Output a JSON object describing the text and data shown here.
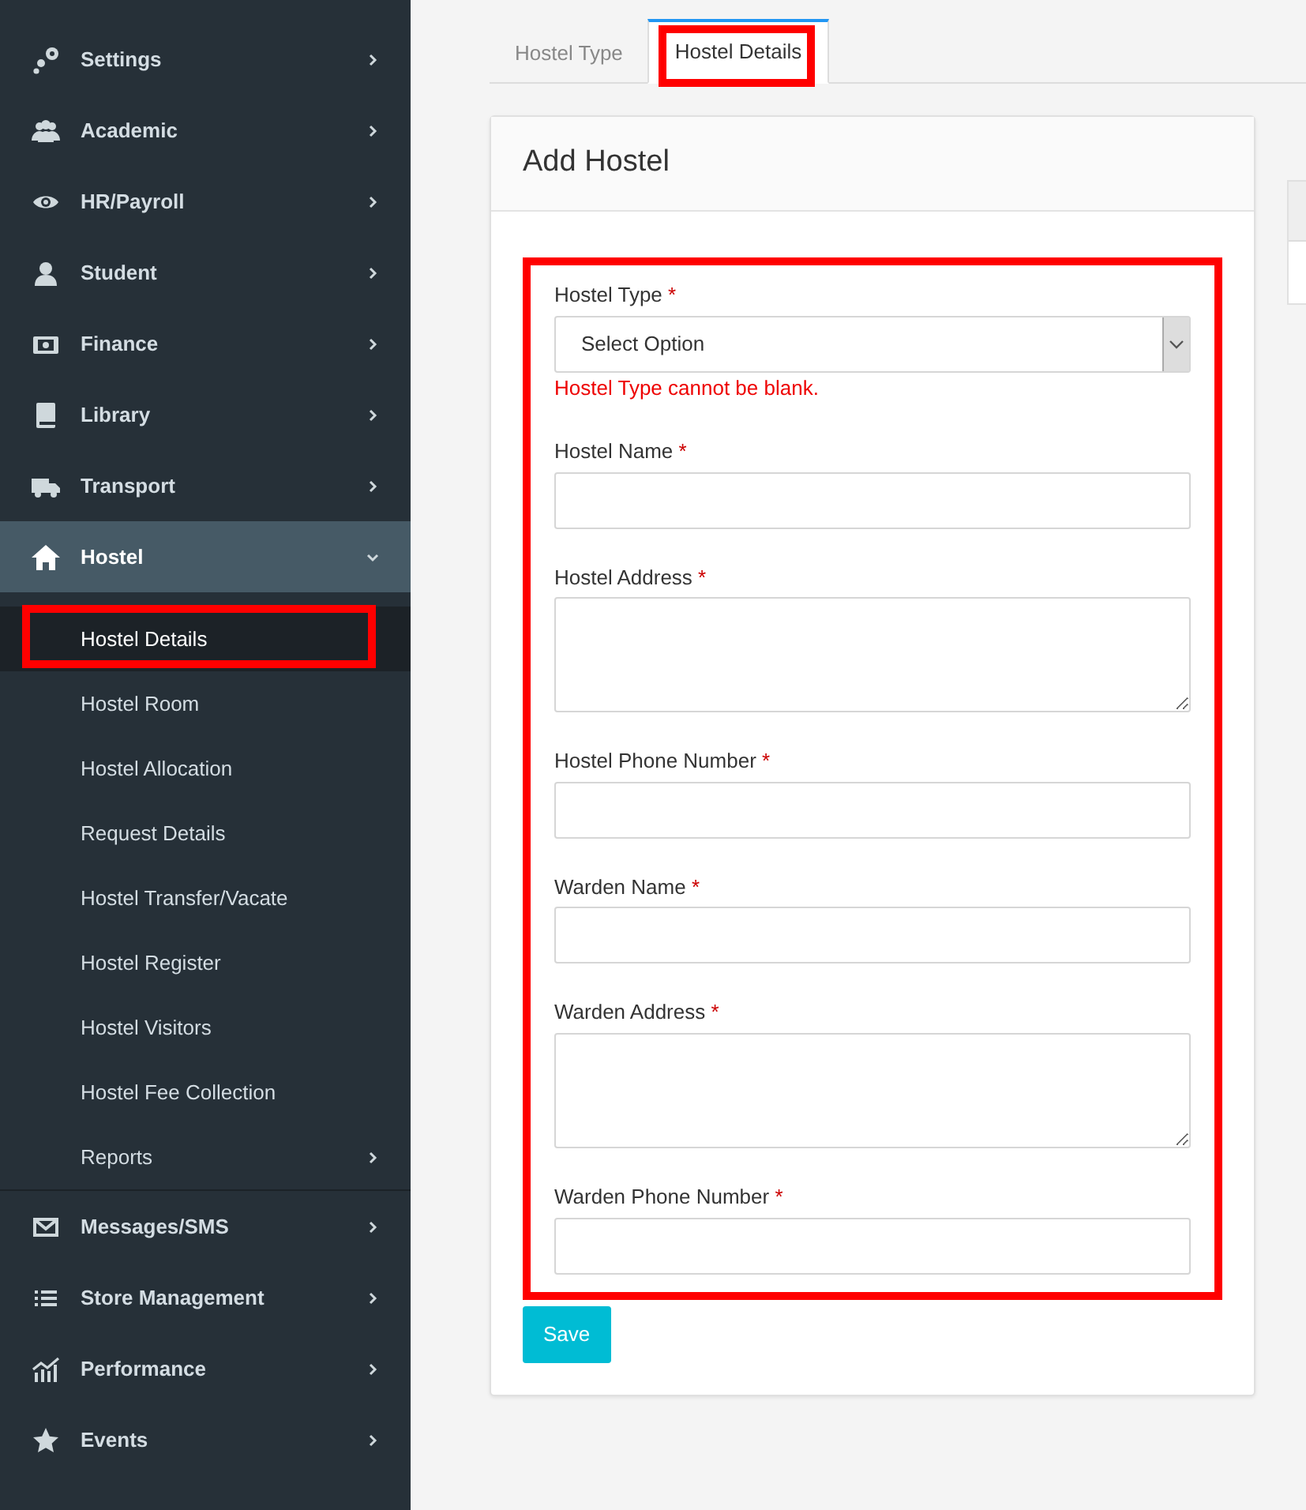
{
  "sidebar": {
    "items": [
      {
        "label": "Settings",
        "expanded": false,
        "selected": false
      },
      {
        "label": "Academic",
        "expanded": false,
        "selected": false
      },
      {
        "label": "HR/Payroll",
        "expanded": false,
        "selected": false
      },
      {
        "label": "Student",
        "expanded": false,
        "selected": false
      },
      {
        "label": "Finance",
        "expanded": false,
        "selected": false
      },
      {
        "label": "Library",
        "expanded": false,
        "selected": false
      },
      {
        "label": "Transport",
        "expanded": false,
        "selected": false
      },
      {
        "label": "Hostel",
        "expanded": true,
        "selected": true,
        "children": [
          {
            "label": "Hostel Details",
            "selected": true,
            "highlighted": true,
            "has_submenu": false
          },
          {
            "label": "Hostel Room",
            "selected": false,
            "highlighted": false,
            "has_submenu": false
          },
          {
            "label": "Hostel Allocation",
            "selected": false,
            "highlighted": false,
            "has_submenu": false
          },
          {
            "label": "Request Details",
            "selected": false,
            "highlighted": false,
            "has_submenu": false
          },
          {
            "label": "Hostel Transfer/Vacate",
            "selected": false,
            "highlighted": false,
            "has_submenu": false
          },
          {
            "label": "Hostel Register",
            "selected": false,
            "highlighted": false,
            "has_submenu": false
          },
          {
            "label": "Hostel Visitors",
            "selected": false,
            "highlighted": false,
            "has_submenu": false
          },
          {
            "label": "Hostel Fee Collection",
            "selected": false,
            "highlighted": false,
            "has_submenu": false
          },
          {
            "label": "Reports",
            "selected": false,
            "highlighted": false,
            "has_submenu": true
          }
        ]
      },
      {
        "label": "Messages/SMS",
        "expanded": false,
        "selected": false
      },
      {
        "label": "Store Management",
        "expanded": false,
        "selected": false
      },
      {
        "label": "Performance",
        "expanded": false,
        "selected": false
      },
      {
        "label": "Events",
        "expanded": false,
        "selected": false
      }
    ]
  },
  "tabs": [
    {
      "label": "Hostel Type",
      "selected": false,
      "highlighted": false
    },
    {
      "label": "Hostel Details",
      "selected": true,
      "highlighted": true
    }
  ],
  "form": {
    "title": "Add Hostel",
    "highlighted": true,
    "fields": [
      {
        "label": "Hostel Type",
        "required": "*",
        "kind": "select",
        "value": "Select Option",
        "error": "Hostel Type cannot be blank."
      },
      {
        "label": "Hostel Name",
        "required": "*",
        "kind": "text"
      },
      {
        "label": "Hostel Address",
        "required": "*",
        "kind": "textarea"
      },
      {
        "label": "Hostel Phone Number",
        "required": "*",
        "kind": "text"
      },
      {
        "label": "Warden Name",
        "required": "*",
        "kind": "text"
      },
      {
        "label": "Warden Address",
        "required": "*",
        "kind": "textarea"
      },
      {
        "label": "Warden Phone Number",
        "required": "*",
        "kind": "text"
      }
    ],
    "submit": "Save"
  }
}
